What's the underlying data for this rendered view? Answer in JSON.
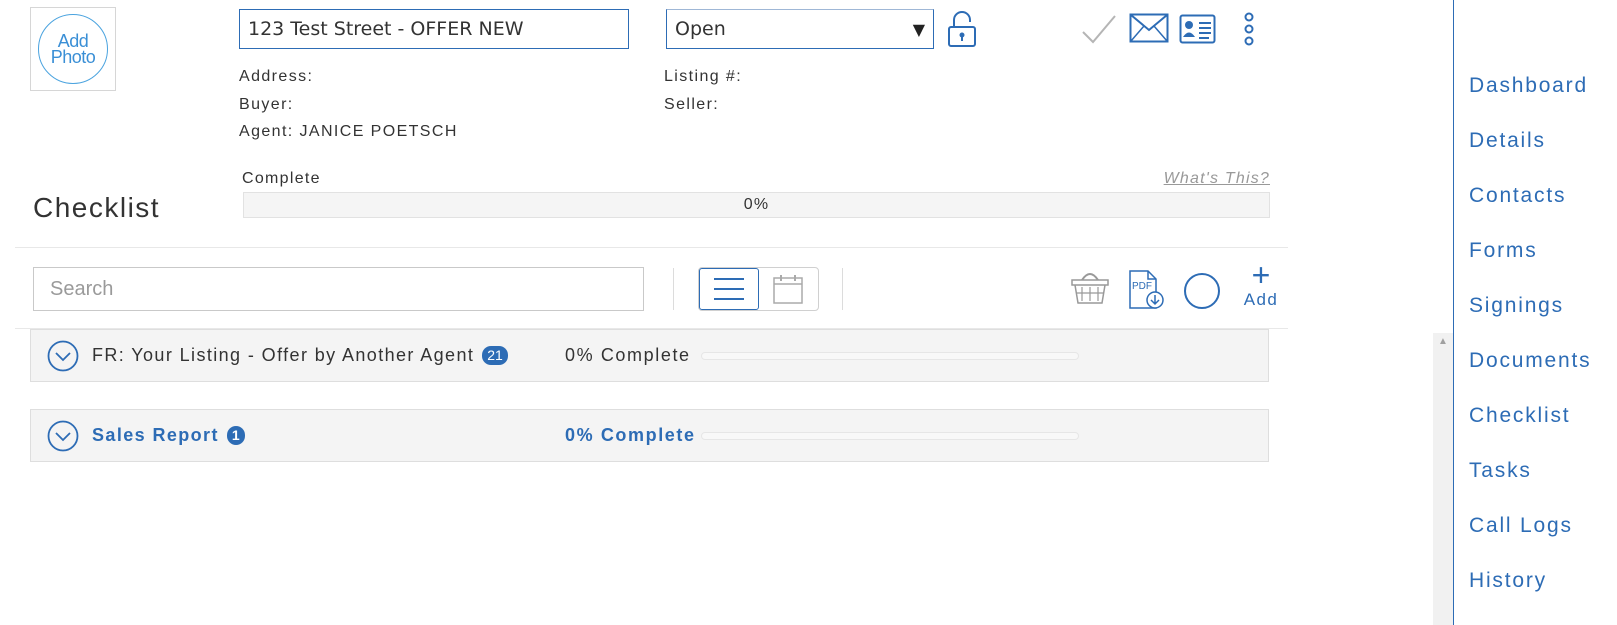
{
  "header": {
    "photo_line1": "Add",
    "photo_line2": "Photo",
    "title_value": "123 Test Street - OFFER NEW",
    "status_value": "Open",
    "address_label": "Address:",
    "buyer_label": "Buyer:",
    "agent_label": "Agent: JANICE POETSCH",
    "listing_label": "Listing #:",
    "seller_label": "Seller:"
  },
  "progress": {
    "label": "Complete",
    "whats_this": "What's This?",
    "percent_text": "0%",
    "fraction": 0
  },
  "checklist": {
    "title": "Checklist",
    "search_placeholder": "Search",
    "add_label": "Add",
    "groups": [
      {
        "name": "FR: Your Listing - Offer by Another Agent",
        "count": "21",
        "percent_text": "0% Complete",
        "fraction": 0
      },
      {
        "name": "Sales Report",
        "count": "1",
        "percent_text": "0% Complete",
        "fraction": 0
      }
    ]
  },
  "sidebar": {
    "items": [
      {
        "label": "Dashboard"
      },
      {
        "label": "Details"
      },
      {
        "label": "Contacts"
      },
      {
        "label": "Forms"
      },
      {
        "label": "Signings"
      },
      {
        "label": "Documents"
      },
      {
        "label": "Checklist"
      },
      {
        "label": "Tasks"
      },
      {
        "label": "Call Logs"
      },
      {
        "label": "History"
      }
    ]
  },
  "colors": {
    "accent": "#2d6cb5",
    "photo": "#4aa3df",
    "muted": "#999999"
  },
  "icons": [
    "lock-open-icon",
    "check-icon",
    "envelope-icon",
    "contact-card-icon",
    "more-vertical-icon",
    "list-view-icon",
    "calendar-view-icon",
    "basket-icon",
    "pdf-download-icon",
    "circle-icon",
    "plus-icon",
    "chevron-down-icon",
    "scroll-up-arrow-icon"
  ]
}
